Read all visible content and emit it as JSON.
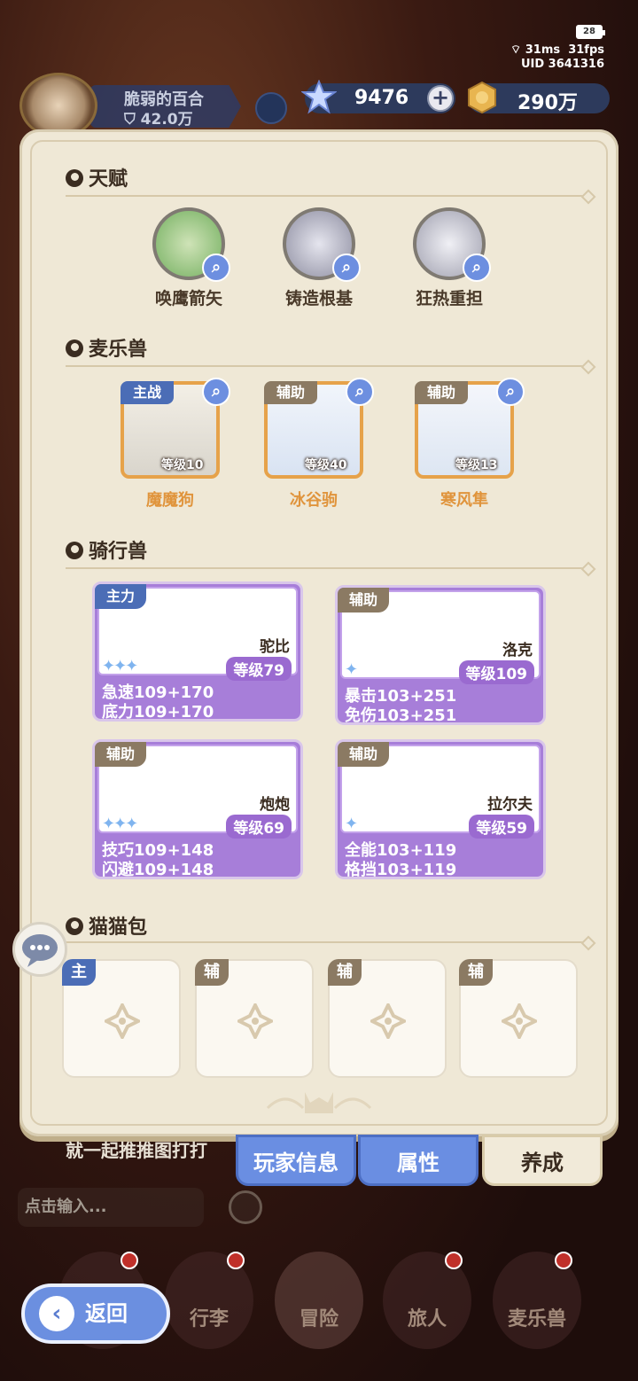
{
  "status": {
    "battery": "28",
    "ping": "31ms",
    "fps": "31fps",
    "uid": "UID 3641316"
  },
  "player": {
    "name": "脆弱的百合",
    "power": "42.0万"
  },
  "currency": {
    "gems": "9476",
    "gold": "290万",
    "plus": "+"
  },
  "talents": {
    "title": "天赋",
    "items": [
      {
        "label": "唤鹰箭矢",
        "color": "#8fbf7a"
      },
      {
        "label": "铸造根基",
        "color": "#a8a8b8"
      },
      {
        "label": "狂热重担",
        "color": "#b8b8c4"
      }
    ]
  },
  "pets": {
    "title": "麦乐兽",
    "items": [
      {
        "role": "主战",
        "level": "等级10",
        "name": "魔魔狗"
      },
      {
        "role": "辅助",
        "level": "等级40",
        "name": "冰谷驹"
      },
      {
        "role": "辅助",
        "level": "等级13",
        "name": "寒风隼"
      }
    ]
  },
  "mounts": {
    "title": "骑行兽",
    "items": [
      {
        "role": "主力",
        "name": "驼比",
        "level": "等级79",
        "stars": "✦✦✦",
        "stat1": "急速109+170",
        "stat2": "底力109+170"
      },
      {
        "role": "辅助",
        "name": "洛克",
        "level": "等级109",
        "stars": "✦",
        "stat1": "暴击103+251",
        "stat2": "免伤103+251"
      },
      {
        "role": "辅助",
        "name": "炮炮",
        "level": "等级69",
        "stars": "✦✦✦",
        "stat1": "技巧109+148",
        "stat2": "闪避109+148"
      },
      {
        "role": "辅助",
        "name": "拉尔夫",
        "level": "等级59",
        "stars": "✦",
        "stat1": "全能103+119",
        "stat2": "格挡103+119"
      }
    ]
  },
  "catbag": {
    "title": "猫猫包",
    "slots": [
      {
        "tag": "主"
      },
      {
        "tag": "辅"
      },
      {
        "tag": "辅"
      },
      {
        "tag": "辅"
      }
    ]
  },
  "chat": {
    "line": "就一起推推图打打",
    "placeholder": "点击输入..."
  },
  "tabs": {
    "info": "玩家信息",
    "attr": "属性",
    "grow": "养成"
  },
  "nav": {
    "bag": "行李",
    "adventure": "冒险",
    "traveler": "旅人",
    "pets": "麦乐兽"
  },
  "back": {
    "label": "返回"
  },
  "colors": {
    "accent_blue": "#6b8fe0",
    "panel": "#efe8d6",
    "mount_purple": "#a77ed9",
    "pet_orange": "#e6a24a"
  }
}
